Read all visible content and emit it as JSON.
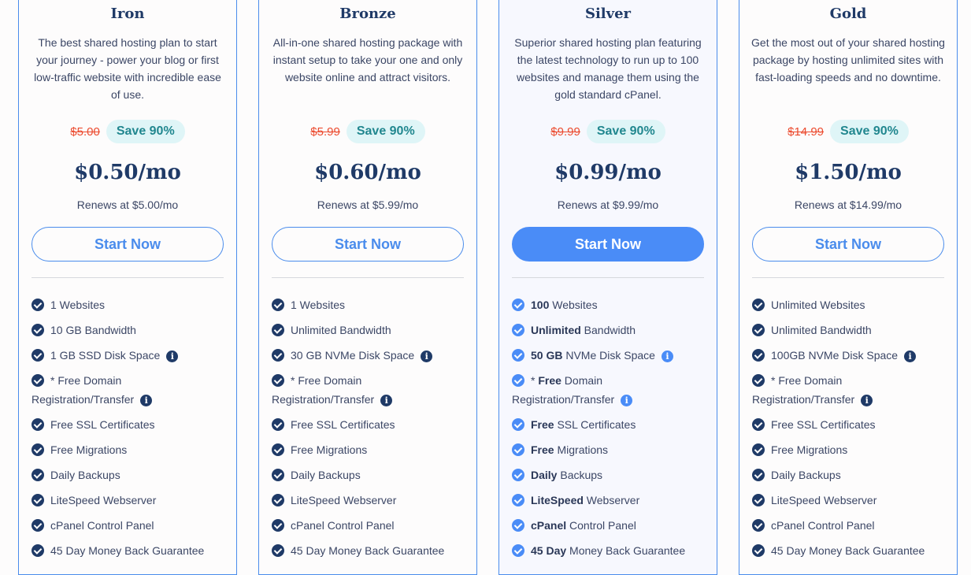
{
  "plans": [
    {
      "name": "Iron",
      "description": "The best shared hosting plan to start your journey - power your blog or first low-traffic website with incredible ease of use.",
      "old_price": "$5.00",
      "save_badge": "Save 90%",
      "price": "$0.50/mo",
      "renews": "Renews at $5.00/mo",
      "cta": "Start Now",
      "featured": false,
      "features": [
        {
          "bold": "",
          "text": "1 Websites",
          "info": false
        },
        {
          "bold": "",
          "text": "10 GB Bandwidth",
          "info": false
        },
        {
          "bold": "",
          "text": "1 GB SSD Disk Space",
          "info": true
        },
        {
          "prefix": "* ",
          "bold": "",
          "text": "Free Domain Registration/Transfer",
          "info": true
        },
        {
          "bold": "",
          "text": "Free SSL Certificates",
          "info": false
        },
        {
          "bold": "",
          "text": "Free Migrations",
          "info": false
        },
        {
          "bold": "",
          "text": "Daily Backups",
          "info": false
        },
        {
          "bold": "",
          "text": "LiteSpeed Webserver",
          "info": false
        },
        {
          "bold": "",
          "text": "cPanel Control Panel",
          "info": false
        },
        {
          "bold": "",
          "text": "45 Day Money Back Guarantee",
          "info": false
        }
      ]
    },
    {
      "name": "Bronze",
      "description": "All-in-one shared hosting package with instant setup to take your one and only website online and attract visitors.",
      "old_price": "$5.99",
      "save_badge": "Save 90%",
      "price": "$0.60/mo",
      "renews": "Renews at $5.99/mo",
      "cta": "Start Now",
      "featured": false,
      "features": [
        {
          "bold": "",
          "text": "1 Websites",
          "info": false
        },
        {
          "bold": "",
          "text": "Unlimited Bandwidth",
          "info": false
        },
        {
          "bold": "",
          "text": "30 GB NVMe Disk Space",
          "info": true
        },
        {
          "prefix": "* ",
          "bold": "",
          "text": "Free Domain Registration/Transfer",
          "info": true
        },
        {
          "bold": "",
          "text": "Free SSL Certificates",
          "info": false
        },
        {
          "bold": "",
          "text": "Free Migrations",
          "info": false
        },
        {
          "bold": "",
          "text": "Daily Backups",
          "info": false
        },
        {
          "bold": "",
          "text": "LiteSpeed Webserver",
          "info": false
        },
        {
          "bold": "",
          "text": "cPanel Control Panel",
          "info": false
        },
        {
          "bold": "",
          "text": "45 Day Money Back Guarantee",
          "info": false
        }
      ]
    },
    {
      "name": "Silver",
      "description": "Superior shared hosting plan featuring the latest technology to run up to 100 websites and manage them using the gold standard cPanel.",
      "old_price": "$9.99",
      "save_badge": "Save 90%",
      "price": "$0.99/mo",
      "renews": "Renews at $9.99/mo",
      "cta": "Start Now",
      "featured": true,
      "features": [
        {
          "bold": "100",
          "text": " Websites",
          "info": false
        },
        {
          "bold": "Unlimited",
          "text": " Bandwidth",
          "info": false
        },
        {
          "bold": "50 GB",
          "text": " NVMe Disk Space",
          "info": true
        },
        {
          "prefix": "* ",
          "bold": "Free",
          "text": " Domain Registration/Transfer",
          "info": true
        },
        {
          "bold": "Free",
          "text": " SSL Certificates",
          "info": false
        },
        {
          "bold": "Free",
          "text": " Migrations",
          "info": false
        },
        {
          "bold": "Daily",
          "text": " Backups",
          "info": false
        },
        {
          "bold": "LiteSpeed",
          "text": " Webserver",
          "info": false
        },
        {
          "bold": "cPanel",
          "text": " Control Panel",
          "info": false
        },
        {
          "bold": "45 Day",
          "text": " Money Back Guarantee",
          "info": false
        }
      ]
    },
    {
      "name": "Gold",
      "description": "Get the most out of your shared hosting package by hosting unlimited sites with fast-loading speeds and no downtime.",
      "old_price": "$14.99",
      "save_badge": "Save 90%",
      "price": "$1.50/mo",
      "renews": "Renews at $14.99/mo",
      "cta": "Start Now",
      "featured": false,
      "features": [
        {
          "bold": "",
          "text": "Unlimited Websites",
          "info": false
        },
        {
          "bold": "",
          "text": "Unlimited Bandwidth",
          "info": false
        },
        {
          "bold": "",
          "text": "100GB NVMe Disk Space",
          "info": true
        },
        {
          "prefix": "* ",
          "bold": "",
          "text": "Free Domain Registration/Transfer",
          "info": true
        },
        {
          "bold": "",
          "text": "Free SSL Certificates",
          "info": false
        },
        {
          "bold": "",
          "text": "Free Migrations",
          "info": false
        },
        {
          "bold": "",
          "text": "Daily Backups",
          "info": false
        },
        {
          "bold": "",
          "text": "LiteSpeed Webserver",
          "info": false
        },
        {
          "bold": "",
          "text": "cPanel Control Panel",
          "info": false
        },
        {
          "bold": "",
          "text": "45 Day Money Back Guarantee",
          "info": false
        }
      ]
    }
  ],
  "colors": {
    "accent": "#4a8cf7",
    "navy": "#1f3a67",
    "strike_red": "#ec4b2f",
    "badge_bg": "#dff5f7",
    "badge_text": "#21878f"
  }
}
